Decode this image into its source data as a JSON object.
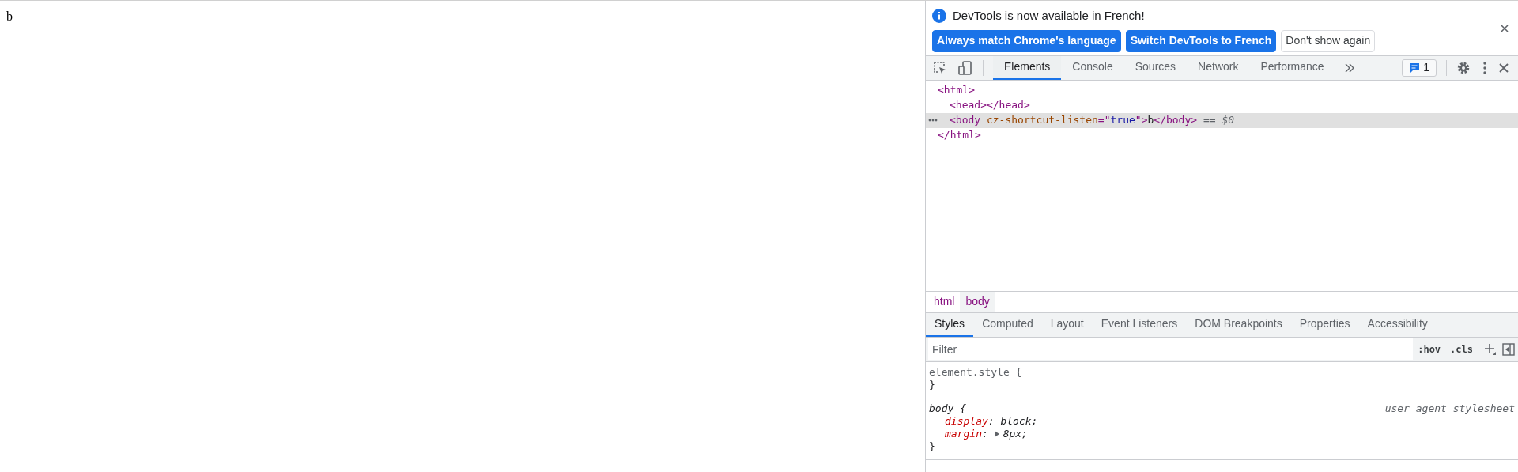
{
  "page": {
    "text": "b"
  },
  "infobar": {
    "message": "DevTools is now available in French!",
    "buttons": [
      {
        "label": "Always match Chrome's language",
        "kind": "primary"
      },
      {
        "label": "Switch DevTools to French",
        "kind": "primary"
      },
      {
        "label": "Don't show again",
        "kind": "secondary"
      }
    ]
  },
  "toolbar": {
    "tabs": [
      {
        "label": "Elements",
        "selected": true
      },
      {
        "label": "Console",
        "selected": false
      },
      {
        "label": "Sources",
        "selected": false
      },
      {
        "label": "Network",
        "selected": false
      },
      {
        "label": "Performance",
        "selected": false
      }
    ],
    "issues_count": "1"
  },
  "dom_tree": [
    {
      "selected": false,
      "tokens": [
        {
          "kind": "tag",
          "text": "<html>"
        }
      ],
      "children": [
        {
          "selected": false,
          "tokens": [
            {
              "kind": "tag",
              "text": "<head></head>"
            }
          ]
        },
        {
          "selected": true,
          "tokens": [
            {
              "kind": "tag",
              "text": "<body"
            },
            {
              "kind": "attr_name",
              "text": " cz-shortcut-listen"
            },
            {
              "kind": "punct",
              "text": "=\""
            },
            {
              "kind": "attr_value",
              "text": "true"
            },
            {
              "kind": "punct",
              "text": "\""
            },
            {
              "kind": "tag",
              "text": ">"
            },
            {
              "kind": "text",
              "text": "b"
            },
            {
              "kind": "tag",
              "text": "</body>"
            },
            {
              "kind": "marker",
              "text": " == $0"
            }
          ]
        }
      ]
    },
    {
      "selected": false,
      "tokens": [
        {
          "kind": "tag",
          "text": "</html>"
        }
      ]
    }
  ],
  "breadcrumbs": [
    {
      "label": "html",
      "selected": false
    },
    {
      "label": "body",
      "selected": true
    }
  ],
  "sidebar_tabs": [
    {
      "label": "Styles",
      "selected": true
    },
    {
      "label": "Computed",
      "selected": false
    },
    {
      "label": "Layout",
      "selected": false
    },
    {
      "label": "Event Listeners",
      "selected": false
    },
    {
      "label": "DOM Breakpoints",
      "selected": false
    },
    {
      "label": "Properties",
      "selected": false
    },
    {
      "label": "Accessibility",
      "selected": false
    }
  ],
  "filter": {
    "placeholder": "Filter",
    "buttons": [
      ":hov",
      ".cls"
    ]
  },
  "rules": [
    {
      "kind": "inline",
      "selector": "element.style",
      "open_brace": "{",
      "close_brace": "}"
    },
    {
      "kind": "user_agent",
      "selector": "body",
      "open_brace": "{",
      "close_brace": "}",
      "source": "user agent stylesheet",
      "declarations": [
        {
          "property": "display",
          "separator": ":",
          "value": "block;",
          "expandable": false
        },
        {
          "property": "margin",
          "separator": ":",
          "value": "8px;",
          "expandable": true
        }
      ]
    }
  ]
}
